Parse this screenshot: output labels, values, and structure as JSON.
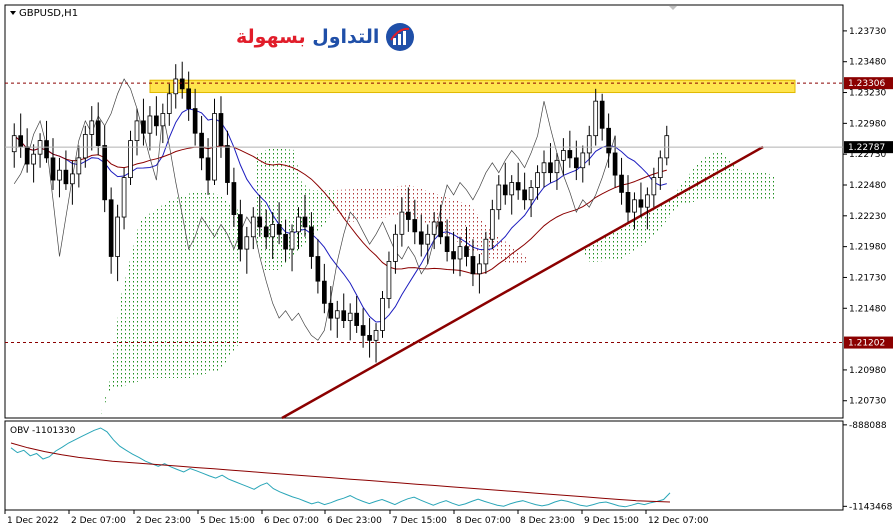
{
  "window": {
    "symbol_label": "GBPUSD,H1"
  },
  "logo": {
    "text_red": "بسهولة",
    "text_blue": "التداول"
  },
  "chart_data": [
    {
      "type": "candlestick",
      "title": "GBPUSD,H1",
      "ylim": [
        1.2059,
        1.2394
      ],
      "y_ticks": [
        "1.23730",
        "1.23480",
        "1.23230",
        "1.22980",
        "1.22730",
        "1.22480",
        "1.22230",
        "1.21980",
        "1.21730",
        "1.21480",
        "1.20980",
        "1.20730"
      ],
      "x_ticks": [
        "1 Dec 2022",
        "2 Dec 07:00",
        "2 Dec 23:00",
        "5 Dec 15:00",
        "6 Dec 07:00",
        "6 Dec 23:00",
        "7 Dec 15:00",
        "8 Dec 07:00",
        "8 Dec 23:00",
        "9 Dec 15:00",
        "12 Dec 07:00"
      ],
      "levels": [
        {
          "label": "1.23306",
          "value": 1.23306,
          "color": "#8b0000",
          "style": "dashed"
        },
        {
          "label": "1.22787",
          "value": 1.22787,
          "color": "#000000",
          "style": "current-price"
        },
        {
          "label": "1.21202",
          "value": 1.21202,
          "color": "#8b0000",
          "style": "dashed"
        }
      ],
      "resistance_zone": {
        "from": 1.2323,
        "to": 1.2333,
        "color": "#ffe44d"
      },
      "trendline": {
        "from": {
          "x": "6 Dec 03:00",
          "y": 1.2067
        },
        "to": {
          "x": "12 Dec 18:00",
          "y": 1.2275
        },
        "color": "#8b0000"
      },
      "ohlc": [
        [
          1.2275,
          1.2298,
          1.2262,
          1.2288
        ],
        [
          1.2288,
          1.2306,
          1.227,
          1.2279
        ],
        [
          1.2279,
          1.2294,
          1.2258,
          1.2265
        ],
        [
          1.2265,
          1.2281,
          1.225,
          1.2273
        ],
        [
          1.2273,
          1.229,
          1.2262,
          1.2284
        ],
        [
          1.2284,
          1.23,
          1.2266,
          1.227
        ],
        [
          1.227,
          1.2286,
          1.2244,
          1.2252
        ],
        [
          1.2252,
          1.227,
          1.2238,
          1.226
        ],
        [
          1.226,
          1.2276,
          1.2244,
          1.2249
        ],
        [
          1.2249,
          1.2268,
          1.2232,
          1.2257
        ],
        [
          1.2257,
          1.228,
          1.2246,
          1.227
        ],
        [
          1.227,
          1.2296,
          1.2262,
          1.2289
        ],
        [
          1.2289,
          1.2312,
          1.2276,
          1.23
        ],
        [
          1.23,
          1.2315,
          1.2272,
          1.228
        ],
        [
          1.228,
          1.2296,
          1.2226,
          1.2236
        ],
        [
          1.2236,
          1.2246,
          1.2176,
          1.219
        ],
        [
          1.219,
          1.2232,
          1.217,
          1.2222
        ],
        [
          1.2222,
          1.2262,
          1.2212,
          1.2254
        ],
        [
          1.2254,
          1.2292,
          1.2248,
          1.2284
        ],
        [
          1.2284,
          1.231,
          1.2272,
          1.23
        ],
        [
          1.23,
          1.2318,
          1.228,
          1.229
        ],
        [
          1.229,
          1.2312,
          1.2276,
          1.2304
        ],
        [
          1.2304,
          1.232,
          1.2288,
          1.2296
        ],
        [
          1.2296,
          1.2314,
          1.2282,
          1.2306
        ],
        [
          1.2306,
          1.233,
          1.2296,
          1.2322
        ],
        [
          1.2322,
          1.2346,
          1.231,
          1.2334
        ],
        [
          1.2334,
          1.2348,
          1.2318,
          1.2326
        ],
        [
          1.2326,
          1.234,
          1.23,
          1.231
        ],
        [
          1.231,
          1.2326,
          1.228,
          1.229
        ],
        [
          1.229,
          1.2304,
          1.226,
          1.227
        ],
        [
          1.227,
          1.2286,
          1.224,
          1.2252
        ],
        [
          1.2252,
          1.2318,
          1.2248,
          1.2306
        ],
        [
          1.2306,
          1.232,
          1.227,
          1.228
        ],
        [
          1.228,
          1.2292,
          1.224,
          1.225
        ],
        [
          1.225,
          1.2262,
          1.2214,
          1.2224
        ],
        [
          1.2224,
          1.2236,
          1.2186,
          1.2196
        ],
        [
          1.2196,
          1.2214,
          1.2176,
          1.2206
        ],
        [
          1.2206,
          1.223,
          1.2196,
          1.2222
        ],
        [
          1.2222,
          1.224,
          1.2206,
          1.2214
        ],
        [
          1.2214,
          1.2228,
          1.2196,
          1.2206
        ],
        [
          1.2206,
          1.2226,
          1.2188,
          1.2216
        ],
        [
          1.2216,
          1.2234,
          1.22,
          1.2208
        ],
        [
          1.2208,
          1.222,
          1.2186,
          1.2196
        ],
        [
          1.2196,
          1.2216,
          1.2178,
          1.221
        ],
        [
          1.221,
          1.223,
          1.2196,
          1.2222
        ],
        [
          1.2222,
          1.224,
          1.2206,
          1.2214
        ],
        [
          1.2214,
          1.2226,
          1.218,
          1.219
        ],
        [
          1.219,
          1.2204,
          1.216,
          1.217
        ],
        [
          1.217,
          1.2184,
          1.2144,
          1.2152
        ],
        [
          1.2152,
          1.2166,
          1.213,
          1.214
        ],
        [
          1.214,
          1.2154,
          1.2124,
          1.2146
        ],
        [
          1.2146,
          1.216,
          1.2132,
          1.2138
        ],
        [
          1.2138,
          1.2152,
          1.2122,
          1.2144
        ],
        [
          1.2144,
          1.2158,
          1.2128,
          1.2134
        ],
        [
          1.2134,
          1.2148,
          1.2116,
          1.2126
        ],
        [
          1.2126,
          1.214,
          1.2108,
          1.2122
        ],
        [
          1.2122,
          1.2136,
          1.2104,
          1.213
        ],
        [
          1.213,
          1.2162,
          1.2124,
          1.2156
        ],
        [
          1.2156,
          1.2194,
          1.2148,
          1.2186
        ],
        [
          1.2186,
          1.2216,
          1.2176,
          1.2208
        ],
        [
          1.2208,
          1.2238,
          1.2198,
          1.2226
        ],
        [
          1.2226,
          1.2246,
          1.221,
          1.222
        ],
        [
          1.222,
          1.2236,
          1.22,
          1.221
        ],
        [
          1.221,
          1.2224,
          1.219,
          1.22
        ],
        [
          1.22,
          1.2216,
          1.2184,
          1.2208
        ],
        [
          1.2208,
          1.2226,
          1.2196,
          1.2218
        ],
        [
          1.2218,
          1.2232,
          1.22,
          1.2206
        ],
        [
          1.2206,
          1.222,
          1.2186,
          1.2194
        ],
        [
          1.2194,
          1.221,
          1.2176,
          1.2188
        ],
        [
          1.2188,
          1.2206,
          1.2174,
          1.2198
        ],
        [
          1.2198,
          1.2214,
          1.2182,
          1.219
        ],
        [
          1.219,
          1.2204,
          1.2166,
          1.2176
        ],
        [
          1.2176,
          1.2192,
          1.216,
          1.2184
        ],
        [
          1.2184,
          1.221,
          1.2176,
          1.2204
        ],
        [
          1.2204,
          1.2236,
          1.2196,
          1.2228
        ],
        [
          1.2228,
          1.2256,
          1.222,
          1.2248
        ],
        [
          1.2248,
          1.2266,
          1.2232,
          1.224
        ],
        [
          1.224,
          1.2256,
          1.2224,
          1.225
        ],
        [
          1.225,
          1.2266,
          1.2236,
          1.2244
        ],
        [
          1.2244,
          1.2258,
          1.2228,
          1.2236
        ],
        [
          1.2236,
          1.2252,
          1.2222,
          1.2246
        ],
        [
          1.2246,
          1.2264,
          1.2236,
          1.2258
        ],
        [
          1.2258,
          1.2276,
          1.2246,
          1.2266
        ],
        [
          1.2266,
          1.2282,
          1.225,
          1.2258
        ],
        [
          1.2258,
          1.2274,
          1.2244,
          1.2268
        ],
        [
          1.2268,
          1.2286,
          1.2256,
          1.2276
        ],
        [
          1.2276,
          1.2292,
          1.2262,
          1.227
        ],
        [
          1.227,
          1.2284,
          1.2252,
          1.2262
        ],
        [
          1.2262,
          1.228,
          1.225,
          1.2274
        ],
        [
          1.2274,
          1.2296,
          1.2264,
          1.2288
        ],
        [
          1.2288,
          1.2326,
          1.228,
          1.2316
        ],
        [
          1.2316,
          1.2322,
          1.2284,
          1.2294
        ],
        [
          1.2294,
          1.2306,
          1.2262,
          1.2274
        ],
        [
          1.2274,
          1.2288,
          1.2246,
          1.2256
        ],
        [
          1.2256,
          1.227,
          1.2232,
          1.2242
        ],
        [
          1.2242,
          1.2256,
          1.2218,
          1.2226
        ],
        [
          1.2226,
          1.2242,
          1.2212,
          1.2236
        ],
        [
          1.2236,
          1.225,
          1.2222,
          1.223
        ],
        [
          1.223,
          1.2246,
          1.2212,
          1.224
        ],
        [
          1.224,
          1.2262,
          1.223,
          1.2254
        ],
        [
          1.2254,
          1.2276,
          1.2244,
          1.227
        ],
        [
          1.227,
          1.2296,
          1.2264,
          1.2288
        ]
      ],
      "indicators": [
        "Ichimoku Kinko Hyo",
        "Moving Average (blue)",
        "Moving Average (dark red)"
      ]
    },
    {
      "type": "line",
      "title": "OBV -1101330",
      "ylim": [
        -1155000,
        -876000
      ],
      "y_ticks": [
        "-888088",
        "-1143468"
      ],
      "series": [
        {
          "name": "OBV",
          "color": "#2aa6b8",
          "values": [
            -960000,
            -975000,
            -968000,
            -985000,
            -978000,
            -995000,
            -988000,
            -970000,
            -958000,
            -945000,
            -935000,
            -925000,
            -915000,
            -905000,
            -898000,
            -910000,
            -935000,
            -955000,
            -968000,
            -980000,
            -990000,
            -1002000,
            -1010000,
            -1018000,
            -1010000,
            -1020000,
            -1028000,
            -1036000,
            -1025000,
            -1032000,
            -1040000,
            -1048000,
            -1055000,
            -1046000,
            -1058000,
            -1066000,
            -1074000,
            -1082000,
            -1090000,
            -1078000,
            -1070000,
            -1088000,
            -1098000,
            -1106000,
            -1114000,
            -1120000,
            -1128000,
            -1136000,
            -1130000,
            -1138000,
            -1132000,
            -1124000,
            -1118000,
            -1110000,
            -1120000,
            -1128000,
            -1135000,
            -1128000,
            -1122000,
            -1130000,
            -1138000,
            -1128000,
            -1120000,
            -1115000,
            -1124000,
            -1132000,
            -1140000,
            -1132000,
            -1126000,
            -1134000,
            -1141000,
            -1136000,
            -1128000,
            -1121000,
            -1128000,
            -1134000,
            -1140000,
            -1143000,
            -1136000,
            -1130000,
            -1126000,
            -1132000,
            -1138000,
            -1142000,
            -1138000,
            -1130000,
            -1124000,
            -1128000,
            -1134000,
            -1140000,
            -1143000,
            -1138000,
            -1132000,
            -1130000,
            -1136000,
            -1142000,
            -1145000,
            -1140000,
            -1134000,
            -1138000,
            -1132000,
            -1128000,
            -1122000,
            -1101330
          ]
        },
        {
          "name": "MA",
          "color": "#8b0000",
          "values": [
            -945000,
            -960000,
            -972000,
            -982000,
            -990000,
            -996000,
            -1002000,
            -1006000,
            -1010000,
            -1014000,
            -1018000,
            -1022000,
            -1026000,
            -1030000,
            -1034000,
            -1038000,
            -1042000,
            -1046000,
            -1050000,
            -1054000,
            -1058000,
            -1062000,
            -1066000,
            -1070000,
            -1074000,
            -1078000,
            -1082000,
            -1086000,
            -1090000,
            -1094000,
            -1098000,
            -1102000,
            -1106000,
            -1110000,
            -1114000,
            -1118000,
            -1122000,
            -1126000,
            -1128000,
            -1130000
          ]
        }
      ]
    }
  ]
}
